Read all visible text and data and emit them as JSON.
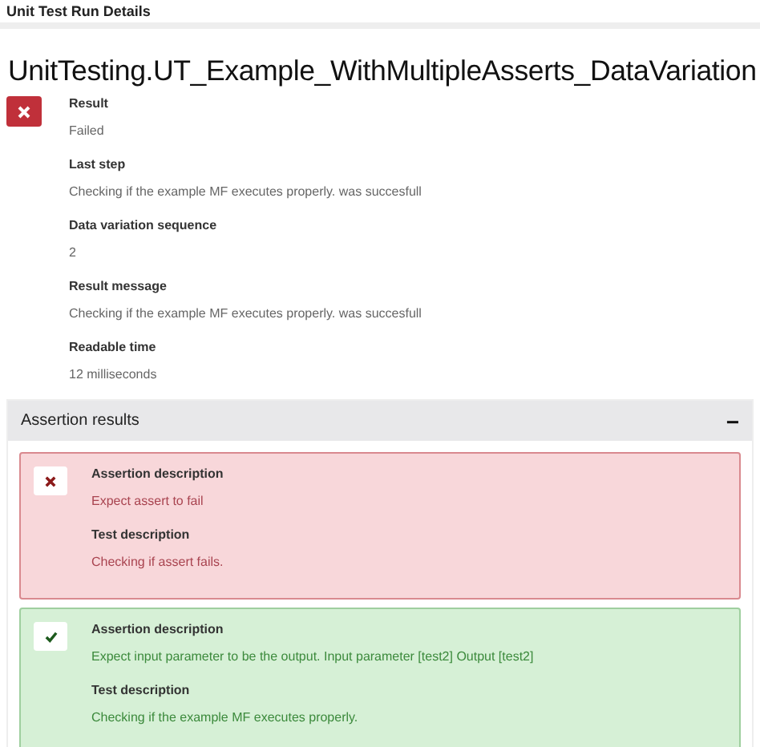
{
  "window": {
    "title": "Unit Test Run Details"
  },
  "test_name": "UnitTesting.UT_Example_WithMultipleAsserts_DataVariation",
  "result": {
    "failed": true
  },
  "fields": [
    {
      "label": "Result",
      "value": "Failed"
    },
    {
      "label": "Last step",
      "value": "Checking if the example MF executes properly. was succesfull"
    },
    {
      "label": "Data variation sequence",
      "value": "2"
    },
    {
      "label": "Result message",
      "value": "Checking if the example MF executes properly. was succesfull"
    },
    {
      "label": "Readable time",
      "value": "12 milliseconds"
    }
  ],
  "assertion_results": {
    "title": "Assertion results",
    "expanded": true,
    "collapse_icon": "−",
    "items": [
      {
        "passed": false,
        "assertion_label": "Assertion description",
        "assertion": "Expect assert to fail",
        "test_label": "Test description",
        "test": "Checking if assert fails."
      },
      {
        "passed": true,
        "assertion_label": "Assertion description",
        "assertion": "Expect input parameter to be the output. Input parameter [test2] Output [test2]",
        "test_label": "Test description",
        "test": "Checking if the example MF executes properly."
      }
    ]
  }
}
